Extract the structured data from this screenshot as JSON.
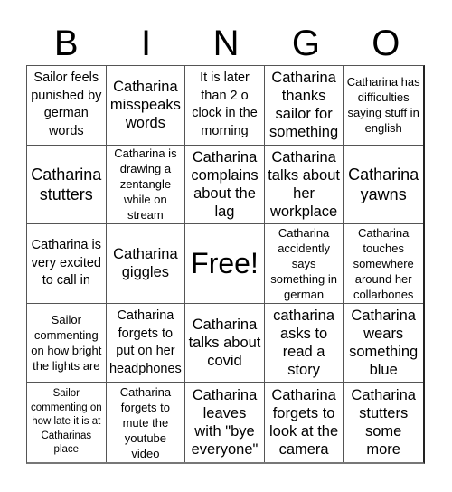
{
  "header": {
    "letters": [
      "B",
      "I",
      "N",
      "G",
      "O"
    ]
  },
  "cells": [
    "Sailor feels punished by german words",
    "Catharina misspeaks words",
    "It is later than 2 o clock in the morning",
    "Catharina thanks sailor for something",
    "Catharina has difficulties saying stuff in english",
    "Catharina stutters",
    "Catharina is drawing a zentangle while on stream",
    "Catharina complains about the lag",
    "Catharina talks about her workplace",
    "Catharina yawns",
    "Catharina is very excited to call in",
    "Catharina giggles",
    "Free!",
    "Catharina accidently says something in german",
    "Catharina touches somewhere around her collarbones",
    "Sailor commenting on how bright the lights are",
    "Catharina forgets to put on her headphones",
    "Catharina talks about covid",
    "catharina asks to read a story",
    "Catharina wears something blue",
    "Sailor commenting on how late it is at Catharinas place",
    "Catharina forgets to mute the youtube video",
    "Catharina leaves with \"bye everyone\"",
    "Catharina forgets to look at the camera",
    "Catharina stutters some more"
  ]
}
